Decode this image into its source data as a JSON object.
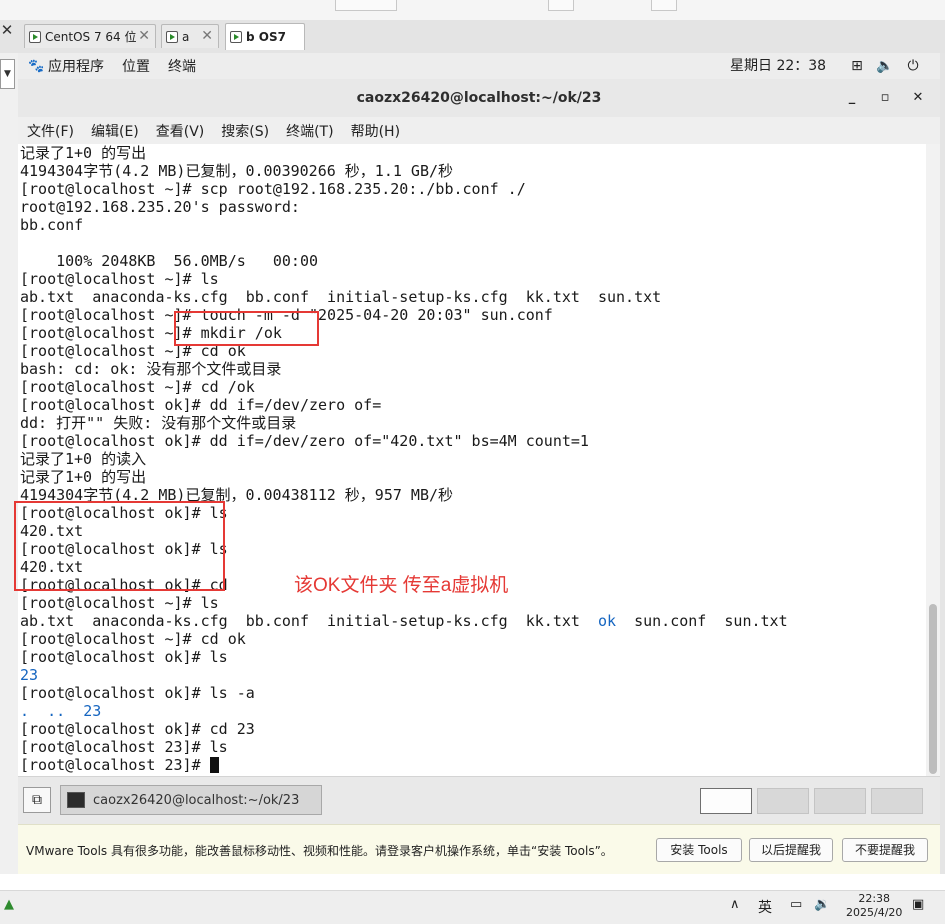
{
  "vm_tabs": [
    {
      "label": "CentOS 7 64 位",
      "active": false
    },
    {
      "label": "a",
      "active": false
    },
    {
      "label": "b OS7",
      "active": true
    }
  ],
  "gnome": {
    "applications": "应用程序",
    "places": "位置",
    "terminal": "终端",
    "clock": "星期日 22：38"
  },
  "window": {
    "title": "caozx26420@localhost:~/ok/23",
    "minimize": "_",
    "maximize": "▫",
    "close": "✕"
  },
  "menu": [
    "文件(F)",
    "编辑(E)",
    "查看(V)",
    "搜索(S)",
    "终端(T)",
    "帮助(H)"
  ],
  "terminal": {
    "lines": [
      [
        {
          "t": "记录了1+0 的写出"
        }
      ],
      [
        {
          "t": "4194304字节(4.2 MB)已复制，0.00390266 秒，1.1 GB/秒"
        }
      ],
      [
        {
          "t": "[root@localhost ~]# scp root@192.168.235.20:./bb.conf ./"
        }
      ],
      [
        {
          "t": "root@192.168.235.20's password:"
        }
      ],
      [
        {
          "t": "bb.conf"
        }
      ],
      [
        {
          "t": ""
        }
      ],
      [
        {
          "t": "    100% 2048KB  56.0MB/s   00:00"
        }
      ],
      [
        {
          "t": "[root@localhost ~]# ls"
        }
      ],
      [
        {
          "t": "ab.txt  anaconda-ks.cfg  bb.conf  initial-setup-ks.cfg  kk.txt  sun.txt"
        }
      ],
      [
        {
          "t": "[root@localhost ~]# touch -m -d \"2025-04-20 20:03\" sun.conf"
        }
      ],
      [
        {
          "t": "[root@localhost ~]# mkdir /ok"
        }
      ],
      [
        {
          "t": "[root@localhost ~]# cd ok"
        }
      ],
      [
        {
          "t": "bash: cd: ok: 没有那个文件或目录"
        }
      ],
      [
        {
          "t": "[root@localhost ~]# cd /ok"
        }
      ],
      [
        {
          "t": "[root@localhost ok]# dd if=/dev/zero of="
        }
      ],
      [
        {
          "t": "dd: 打开\"\" 失败: 没有那个文件或目录"
        }
      ],
      [
        {
          "t": "[root@localhost ok]# dd if=/dev/zero of=\"420.txt\" bs=4M count=1"
        }
      ],
      [
        {
          "t": "记录了1+0 的读入"
        }
      ],
      [
        {
          "t": "记录了1+0 的写出"
        }
      ],
      [
        {
          "t": "4194304字节(4.2 MB)已复制，0.00438112 秒，957 MB/秒"
        }
      ],
      [
        {
          "t": "[root@localhost ok]# ls"
        }
      ],
      [
        {
          "t": "420.txt"
        }
      ],
      [
        {
          "t": "[root@localhost ok]# ls"
        }
      ],
      [
        {
          "t": "420.txt"
        }
      ],
      [
        {
          "t": "[root@localhost ok]# cd"
        }
      ],
      [
        {
          "t": "[root@localhost ~]# ls"
        }
      ],
      [
        {
          "t": "ab.txt  anaconda-ks.cfg  bb.conf  initial-setup-ks.cfg  kk.txt  "
        },
        {
          "t": "ok",
          "blue": true
        },
        {
          "t": "  sun.conf  sun.txt"
        }
      ],
      [
        {
          "t": "[root@localhost ~]# cd ok"
        }
      ],
      [
        {
          "t": "[root@localhost ok]# ls"
        }
      ],
      [
        {
          "t": "23",
          "blue": true
        }
      ],
      [
        {
          "t": "[root@localhost ok]# ls -a"
        }
      ],
      [
        {
          "t": ".  ..  ",
          "blue": true
        },
        {
          "t": "23",
          "blue": true
        }
      ],
      [
        {
          "t": "[root@localhost ok]# cd 23"
        }
      ],
      [
        {
          "t": "[root@localhost 23]# ls"
        }
      ],
      [
        {
          "t": "[root@localhost 23]# "
        },
        {
          "cursor": true
        }
      ]
    ]
  },
  "annotation": "该OK文件夹 传至a虚拟机",
  "taskbar": {
    "item_label": "caozx26420@localhost:~/ok/23"
  },
  "vmware_tools": {
    "message": "VMware Tools 具有很多功能，能改善鼠标移动性、视频和性能。请登录客户机操作系统，单击“安装 Tools”。",
    "install": "安装 Tools",
    "remind_later": "以后提醒我",
    "never_remind": "不要提醒我"
  },
  "windows_taskbar": {
    "ime": "英",
    "time": "22:38",
    "date": "2025/4/20"
  },
  "colors": {
    "blue_dir": "#1565c0",
    "annotation_red": "#e53935"
  }
}
